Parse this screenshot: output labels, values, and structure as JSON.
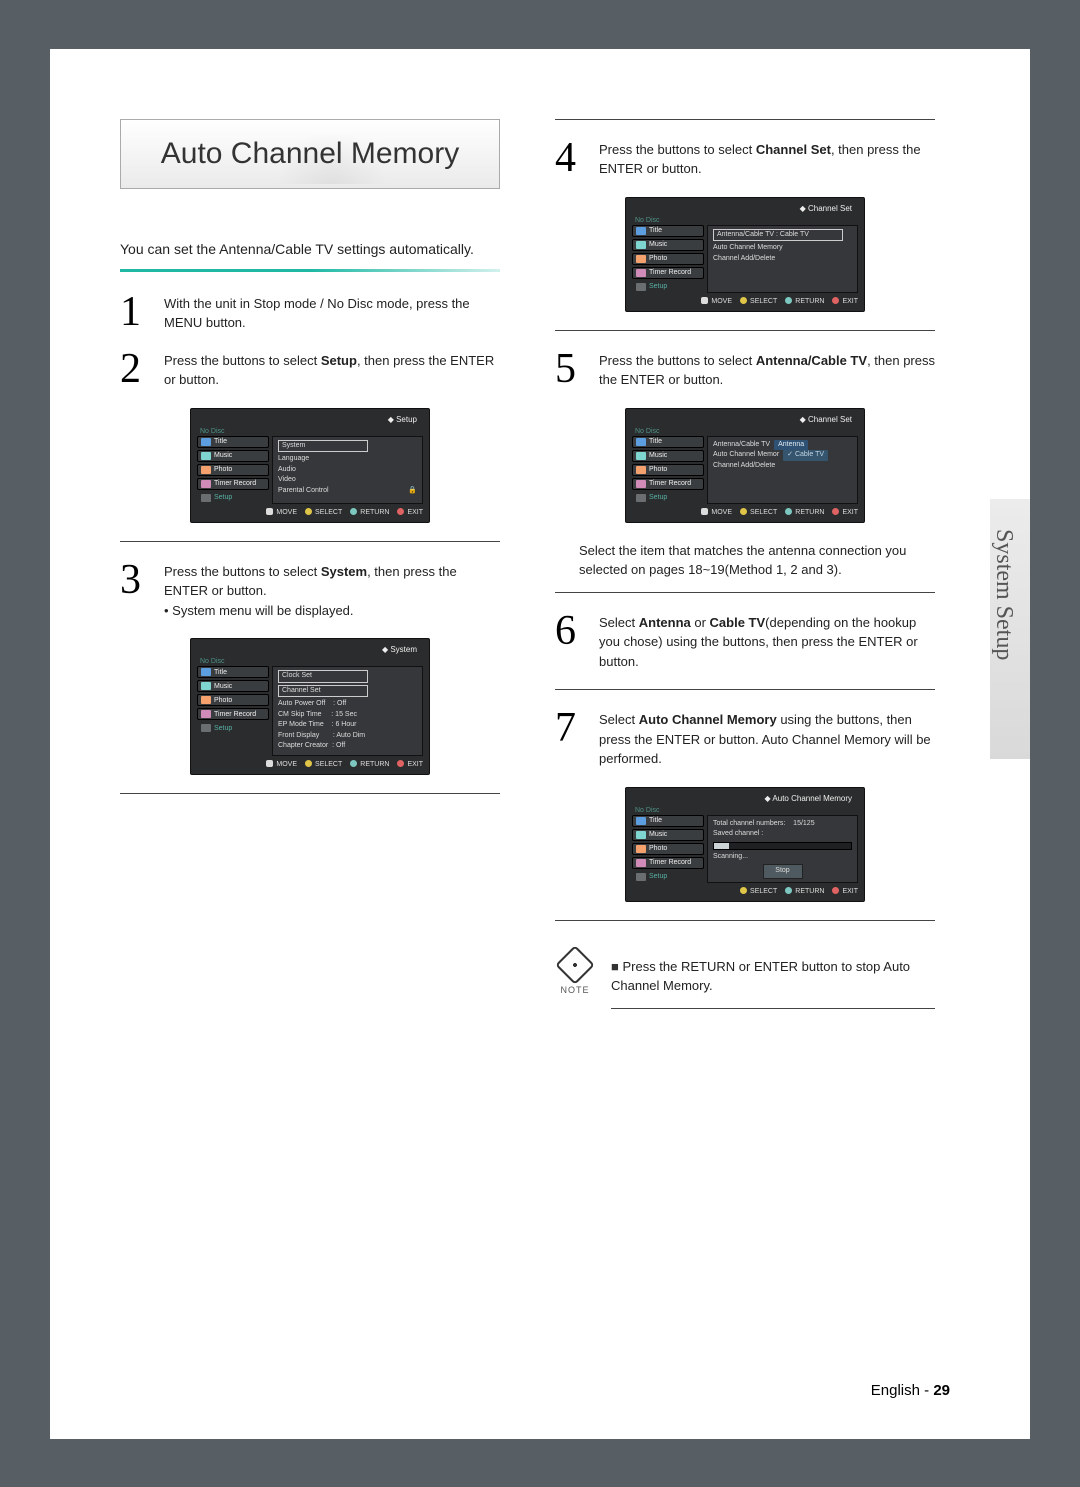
{
  "side_tab": "System Setup",
  "title": "Auto Channel Memory",
  "intro": "You can set the Antenna/Cable TV settings automatically.",
  "steps": {
    "s1": "With the unit in Stop mode / No Disc mode, press the MENU button.",
    "s2a": "Press the ",
    "s2b": " buttons to select ",
    "s2c": "Setup",
    "s2d": ", then press the ENTER or  button.",
    "s3a": "Press the ",
    "s3b": " buttons to select ",
    "s3c": "System",
    "s3d": ", then press the ENTER or  button.",
    "s3e": "• System menu will be displayed.",
    "s4a": "Press the ",
    "s4b": " buttons to select ",
    "s4c": "Channel Set",
    "s4d": ", then press the ENTER or  button.",
    "s5a": "Press the ",
    "s5b": " buttons to select ",
    "s5c": "Antenna/Cable TV",
    "s5d": ", then press the ENTER or  button.",
    "s5note": "Select the item that matches the antenna connection you selected on pages 18~19(Method 1, 2 and 3).",
    "s6a": "Select ",
    "s6b": "Antenna",
    "s6c": " or ",
    "s6d": "Cable TV",
    "s6e": "(depending on the hookup you chose) using the  buttons, then press the ENTER or  button.",
    "s7a": "Select ",
    "s7b": "Auto Channel Memory",
    "s7c": " using the  buttons, then press the ENTER or  button. Auto Channel Memory will be performed."
  },
  "osd": {
    "no_disc": "No Disc",
    "side": {
      "title": "Title",
      "music": "Music",
      "photo": "Photo",
      "timer": "Timer Record",
      "setup": "Setup"
    },
    "footer": {
      "move": "MOVE",
      "select": "SELECT",
      "return": "RETURN",
      "exit": "EXIT"
    },
    "setup_hdr": "Setup",
    "setup_items": {
      "system": "System",
      "language": "Language",
      "audio": "Audio",
      "video": "Video",
      "parental": "Parental Control"
    },
    "system_hdr": "System",
    "system_items": {
      "clock": "Clock Set",
      "channel": "Channel Set",
      "autopoff": "Auto Power Off    : Off",
      "cmskip": "CM Skip Time     : 15 Sec",
      "epmode": "EP Mode Time    : 6 Hour",
      "front": "Front Display       : Auto Dim",
      "chapter": "Chapter Creator  : Off"
    },
    "channel_hdr": "Channel Set",
    "channel_items": {
      "antcable": "Antenna/Cable TV    : Cable TV",
      "acm": "Auto Channel Memory",
      "add": "Channel Add/Delete"
    },
    "ant_popup": {
      "antenna": "Antenna",
      "cable": "Cable TV"
    },
    "acm_hdr": "Auto Channel Memory",
    "acm": {
      "total": "Total channel numbers:",
      "total_v": "15/125",
      "saved": "Saved channel :",
      "pct": "11%",
      "scanning": "Scanning...",
      "stop": "Stop"
    }
  },
  "note": {
    "label": "NOTE",
    "text": "Press the RETURN or ENTER button to stop Auto Channel Memory."
  },
  "footer": {
    "lang": "English - ",
    "page": "29"
  }
}
